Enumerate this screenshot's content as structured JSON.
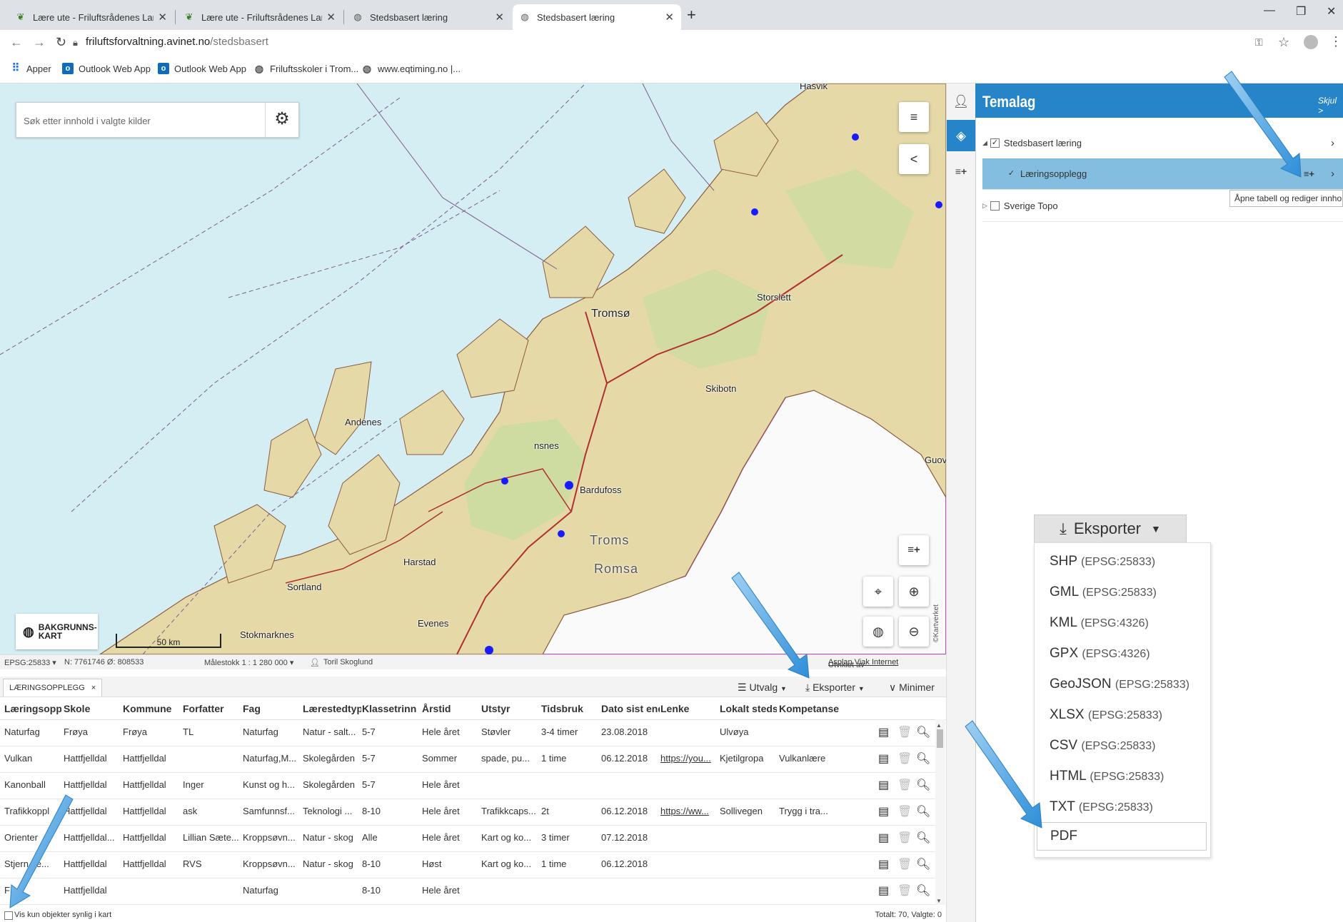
{
  "browser": {
    "tabs": [
      {
        "title": "Lære ute - Friluftsrådenes Landsf",
        "icon": "leaf-icon",
        "active": false
      },
      {
        "title": "Lære ute - Friluftsrådenes Landsf",
        "icon": "leaf-icon",
        "active": false
      },
      {
        "title": "Stedsbasert læring",
        "icon": "globe-icon",
        "active": false
      },
      {
        "title": "Stedsbasert læring",
        "icon": "globe-icon",
        "active": true
      }
    ],
    "url_host": "friluftsforvaltning.avinet.no",
    "url_path": "/stedsbasert",
    "bookmarks": [
      "Apper",
      "Outlook Web App",
      "Outlook Web App",
      "Friluftsskoler i Trom...",
      "www.eqtiming.no |..."
    ]
  },
  "map": {
    "search_placeholder": "Søk etter innhold i valgte kilder",
    "bakgrunn_line1": "BAKGRUNNS-",
    "bakgrunn_line2": "KART",
    "scale": "50 km",
    "labels": {
      "tromso": "Tromsø",
      "storslett": "Storslett",
      "skibotn": "Skibotn",
      "andenes": "Andenes",
      "finnsnes": "nsnes",
      "bardufoss": "Bardufoss",
      "troms": "Troms",
      "romsa": "Romsa",
      "harstad": "Harstad",
      "sortland": "Sortland",
      "stokmarknes": "Stokmarknes",
      "evenes": "Evenes",
      "hasvik": "Hasvik",
      "guov": "Guov"
    },
    "credit": "©Kartverket"
  },
  "statusbar": {
    "epsg": "EPSG:25833 ▾",
    "coords": "N: 7761746 Ø: 808533",
    "scale": "Målestokk 1 : 1 280 000 ▾",
    "user": "Toril Skoglund",
    "credit_prefix": "Utviklet av ",
    "credit_link": "Asplan Viak Internet"
  },
  "panel": {
    "title": "Temalag",
    "hide": "Skjul >",
    "layers": [
      {
        "label": "Stedsbasert læring",
        "checked": true,
        "expanded": true
      },
      {
        "label": "Læringsopplegg",
        "checked": true,
        "selected": true
      },
      {
        "label": "Sverige Topo",
        "checked": false,
        "expanded": false
      }
    ],
    "tooltip": "Åpne tabell og rediger innhold"
  },
  "export": {
    "button": "Eksporter",
    "items": [
      {
        "fmt": "SHP",
        "proj": "(EPSG:25833)"
      },
      {
        "fmt": "GML",
        "proj": "(EPSG:25833)"
      },
      {
        "fmt": "KML",
        "proj": "(EPSG:4326)"
      },
      {
        "fmt": "GPX",
        "proj": "(EPSG:4326)"
      },
      {
        "fmt": "GeoJSON",
        "proj": "(EPSG:25833)"
      },
      {
        "fmt": "XLSX",
        "proj": "(EPSG:25833)"
      },
      {
        "fmt": "CSV",
        "proj": "(EPSG:25833)"
      },
      {
        "fmt": "HTML",
        "proj": "(EPSG:25833)"
      },
      {
        "fmt": "TXT",
        "proj": "(EPSG:25833)"
      }
    ],
    "pdf": "PDF"
  },
  "table": {
    "tab": "LÆRINGSOPPLEGG",
    "utvalg": "Utvalg",
    "eksporter": "Eksporter",
    "minimer": "Minimer",
    "columns": [
      "Læringsopple",
      "Skole",
      "Kommune",
      "Forfatter",
      "Fag",
      "Lærestedtype",
      "Klassetrinn",
      "Årstid",
      "Utstyr",
      "Tidsbruk",
      "Dato sist endr",
      "Lenke",
      "Lokalt stedsn",
      "Kompetanse"
    ],
    "rows": [
      [
        "Naturfag",
        "Frøya",
        "Frøya",
        "TL",
        "Naturfag",
        "Natur - salt...",
        "5-7",
        "Hele året",
        "Støvler",
        "3-4 timer",
        "23.08.2018",
        "",
        "Ulvøya",
        ""
      ],
      [
        "Vulkan",
        "Hattfjelldal",
        "Hattfjelldal",
        "",
        "Naturfag,M...",
        "Skolegården",
        "5-7",
        "Sommer",
        "spade, pu...",
        "1 time",
        "06.12.2018",
        "https://you...",
        "Kjetilgropa",
        "Vulkanlære"
      ],
      [
        "Kanonball",
        "Hattfjelldal",
        "Hattfjelldal",
        "Inger",
        "Kunst og h...",
        "Skolegården",
        "5-7",
        "Hele året",
        "",
        "",
        "",
        "",
        "",
        ""
      ],
      [
        "Trafikkoppl",
        "Hattfjelldal",
        "Hattfjelldal",
        "ask",
        "Samfunnsf...",
        "Teknologi ...",
        "8-10",
        "Hele året",
        "Trafikkcaps...",
        "2t",
        "06.12.2018",
        "https://ww...",
        "Sollivegen",
        "Trygg i tra..."
      ],
      [
        "Orienter",
        "Hattfjelldal...",
        "Hattfjelldal",
        "Lillian Sæte...",
        "Kroppsøvn...",
        "Natur - skog",
        "Alle",
        "Hele året",
        "Kart og ko...",
        "3 timer",
        "07.12.2018",
        "",
        "",
        ""
      ],
      [
        "Stjern...e...",
        "Hattfjelldal",
        "Hattfjelldal",
        "RVS",
        "Kroppsøvn...",
        "Natur - skog",
        "8-10",
        "Høst",
        "Kart og ko...",
        "1 time",
        "06.12.2018",
        "",
        "",
        ""
      ],
      [
        "F",
        "Hattfjelldal",
        "",
        "",
        "Naturfag",
        "",
        "8-10",
        "Hele året",
        "",
        "",
        "",
        "",
        "",
        ""
      ]
    ],
    "footer_check": "Vis kun objekter synlig i kart",
    "total": "Totalt: 70, Valgte: 0"
  },
  "colors": {
    "accent": "#2685c8",
    "selected_layer": "#83bde0",
    "arrow": "#3aa0e0"
  }
}
